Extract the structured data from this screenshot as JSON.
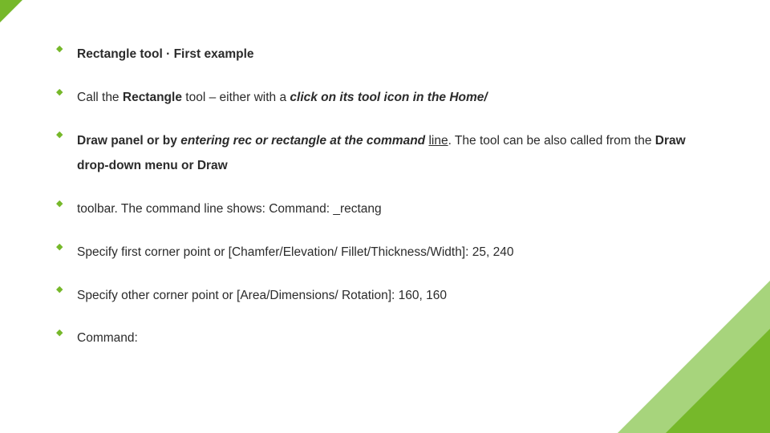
{
  "bullets": [
    {
      "frag0": "Rectangle tool",
      "frag1": " · First example"
    },
    {
      "frag0": " Call the ",
      "frag1": "Rectangle",
      "frag2": " tool – either with a ",
      "frag3": "click",
      "frag4": " on its tool icon in the ",
      "frag5": "Home/"
    },
    {
      "frag0": "Draw",
      "frag1": " panel or by ",
      "frag2": "entering",
      "frag3": "  rec  or  rectangle  at the command ",
      "frag4": "line",
      "frag5": ". The tool can be also called from the ",
      "frag6": "Draw",
      "frag7": " drop-down menu or ",
      "frag8": "Draw"
    },
    {
      "frag0": "toolbar. The command line shows: Command: _rectang"
    },
    {
      "frag0": "Specify first corner point or [Chamfer/Elevation/ Fillet/Thickness/Width]: 25, 240"
    },
    {
      "frag0": "Specify other corner point or [Area/Dimensions/ Rotation]: 160, 160"
    },
    {
      "frag0": "Command:"
    }
  ]
}
